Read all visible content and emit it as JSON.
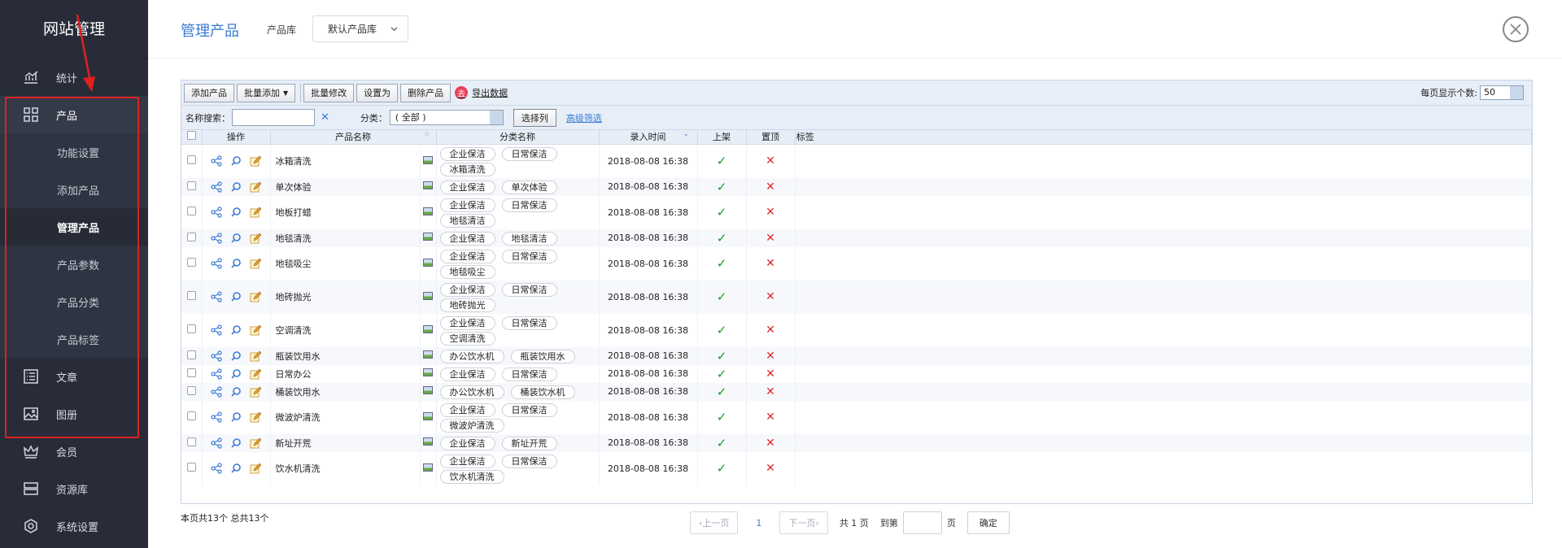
{
  "sidebar": {
    "brand": "网站管理",
    "items": [
      {
        "label": "统计",
        "icon": "chart-icon"
      },
      {
        "label": "产品",
        "icon": "grid-icon"
      },
      {
        "label": "功能设置"
      },
      {
        "label": "添加产品"
      },
      {
        "label": "管理产品"
      },
      {
        "label": "产品参数"
      },
      {
        "label": "产品分类"
      },
      {
        "label": "产品标签"
      },
      {
        "label": "文章",
        "icon": "list-icon"
      },
      {
        "label": "图册",
        "icon": "image-icon"
      },
      {
        "label": "会员",
        "icon": "crown-icon"
      },
      {
        "label": "资源库",
        "icon": "storage-icon"
      },
      {
        "label": "系统设置",
        "icon": "settings-icon"
      }
    ]
  },
  "header": {
    "title": "管理产品",
    "library_label": "产品库",
    "library_value": "默认产品库"
  },
  "toolbar": {
    "add": "添加产品",
    "batch_add": "批量添加",
    "batch_edit": "批量修改",
    "set_as": "设置为",
    "delete": "删除产品",
    "export_icon_char": "去",
    "export": "导出数据",
    "per_page_label": "每页显示个数:",
    "per_page_value": "50"
  },
  "search": {
    "name_label": "名称搜索：",
    "clear": "✕",
    "category_label": "分类：",
    "category_value": "( 全部 )",
    "columns_button": "选择列",
    "advanced_filter": "高级筛选"
  },
  "table": {
    "headers": {
      "actions": "操作",
      "name": "产品名称",
      "category": "分类名称",
      "date": "录入时间",
      "listed": "上架",
      "top": "置顶",
      "tags": "标签"
    },
    "check_mark": "✓",
    "cross_mark": "✕",
    "rows": [
      {
        "name": "冰箱清洗",
        "cats": [
          "企业保洁",
          "日常保洁",
          "冰箱清洗"
        ],
        "date": "2018-08-08 16:38"
      },
      {
        "name": "单次体验",
        "cats": [
          "企业保洁",
          "单次体验"
        ],
        "date": "2018-08-08 16:38"
      },
      {
        "name": "地板打蜡",
        "cats": [
          "企业保洁",
          "日常保洁",
          "地毯清洁"
        ],
        "date": "2018-08-08 16:38"
      },
      {
        "name": "地毯清洗",
        "cats": [
          "企业保洁",
          "地毯清洁"
        ],
        "date": "2018-08-08 16:38"
      },
      {
        "name": "地毯吸尘",
        "cats": [
          "企业保洁",
          "日常保洁",
          "地毯吸尘"
        ],
        "date": "2018-08-08 16:38"
      },
      {
        "name": "地砖抛光",
        "cats": [
          "企业保洁",
          "日常保洁",
          "地砖抛光"
        ],
        "date": "2018-08-08 16:38"
      },
      {
        "name": "空调清洗",
        "cats": [
          "企业保洁",
          "日常保洁",
          "空调清洗"
        ],
        "date": "2018-08-08 16:38"
      },
      {
        "name": "瓶装饮用水",
        "cats": [
          "办公饮水机",
          "瓶装饮用水"
        ],
        "date": "2018-08-08 16:38"
      },
      {
        "name": "日常办公",
        "cats": [
          "企业保洁",
          "日常保洁"
        ],
        "date": "2018-08-08 16:38"
      },
      {
        "name": "桶装饮用水",
        "cats": [
          "办公饮水机",
          "桶装饮水机"
        ],
        "date": "2018-08-08 16:38"
      },
      {
        "name": "微波炉清洗",
        "cats": [
          "企业保洁",
          "日常保洁",
          "微波炉清洗"
        ],
        "date": "2018-08-08 16:38"
      },
      {
        "name": "新址开荒",
        "cats": [
          "企业保洁",
          "新址开荒"
        ],
        "date": "2018-08-08 16:38"
      },
      {
        "name": "饮水机清洗",
        "cats": [
          "企业保洁",
          "日常保洁",
          "饮水机清洗"
        ],
        "date": "2018-08-08 16:38"
      }
    ]
  },
  "footer": {
    "summary": "本页共13个 总共13个",
    "prev": "上一页",
    "current": "1",
    "next": "下一页",
    "total_pages": "共 1 页",
    "goto": "到第",
    "page_unit": "页",
    "confirm": "确定"
  }
}
